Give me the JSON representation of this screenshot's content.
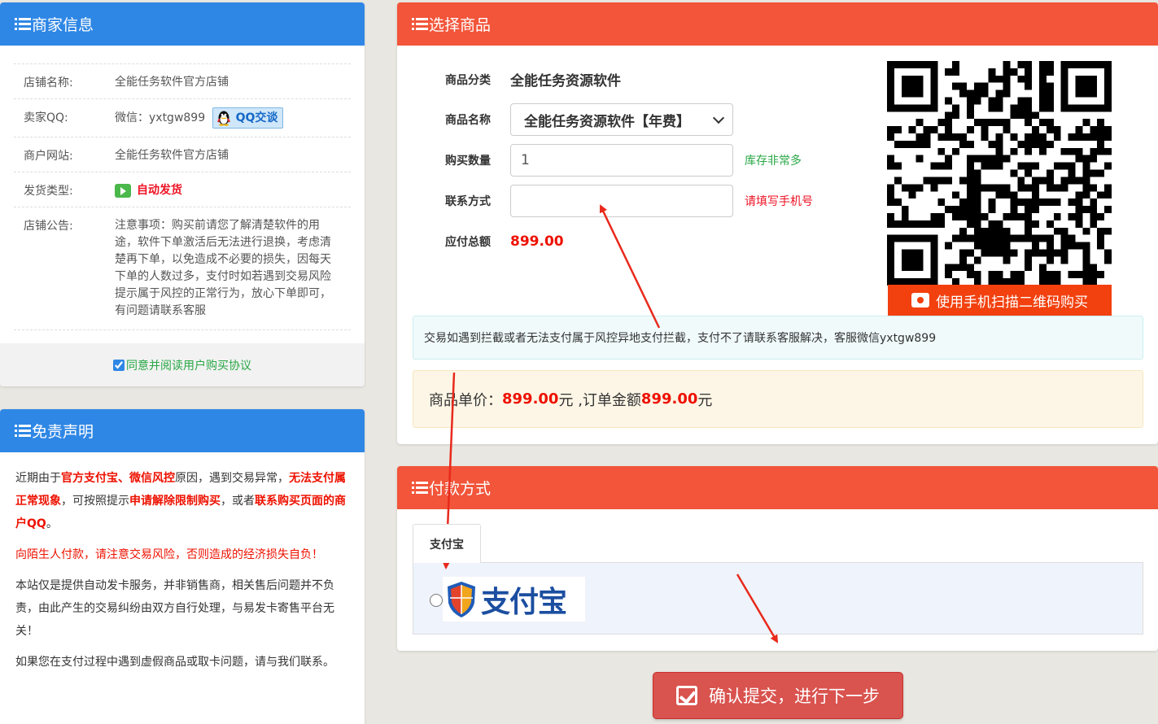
{
  "merchant": {
    "title": "商家信息",
    "rows": [
      {
        "key": "店铺名称:",
        "value": "全能任务软件官方店铺"
      },
      {
        "key": "卖家QQ:",
        "value": "微信：yxtgw899"
      },
      {
        "key": "商户网站:",
        "value": "全能任务软件官方店铺"
      },
      {
        "key": "发货类型:",
        "value": "自动发货"
      },
      {
        "key": "店铺公告:",
        "value": "注意事项：购买前请您了解清楚软件的用途，软件下单激活后无法进行退换，考虑清楚再下单，以免造成不必要的损失，因每天下单的人数过多，支付时如若遇到交易风险提示属于风控的正常行为，放心下单即可，有问题请联系客服"
      }
    ],
    "qq_button": "QQ交谈",
    "agree_label": "同意并阅读用户购买协议",
    "agree_checked": true
  },
  "disclaimer": {
    "title": "免责声明",
    "p1": {
      "a": "近期由于",
      "b": "官方支付宝、微信风控",
      "c": "原因，遇到交易异常，",
      "d": "无法支付属正常现象",
      "e": "，可按照提示",
      "f": "申请解除限制购买",
      "g": "，或者",
      "h": "联系购买页面的商户QQ",
      "i": "。"
    },
    "p2": "向陌生人付款，请注意交易风险，否则造成的经济损失自负！",
    "p3": "本站仅是提供自动发卡服务，并非销售商，相关售后问题并不负责，由此产生的交易纠纷由双方自行处理，与易发卡寄售平台无关！",
    "p4": "如果您在支付过程中遇到虚假商品或取卡问题，请与我们联系。"
  },
  "product": {
    "title": "选择商品",
    "category_label": "商品分类",
    "category_value": "全能任务资源软件",
    "name_label": "商品名称",
    "name_value": "全能任务资源软件【年费】",
    "qty_label": "购买数量",
    "qty_value": "1",
    "stock_hint": "库存非常多",
    "contact_label": "联系方式",
    "contact_value": "",
    "contact_hint": "请填写手机号",
    "total_label": "应付总额",
    "total_value": "899.00",
    "qr_caption": "使用手机扫描二维码购买",
    "risk_notice": "交易如遇到拦截或者无法支付属于风控异地支付拦截，支付不了请联系客服解决，客服微信yxtgw899",
    "price_line": {
      "a": "商品单价：",
      "unit_price": "899.00",
      "b": "元 ,订单金额",
      "order_total": "899.00",
      "c": "元"
    }
  },
  "payment": {
    "title": "付款方式",
    "tab_label": "支付宝",
    "alipay_logo_text": "支付宝"
  },
  "submit_label": "确认提交，进行下一步",
  "colors": {
    "blue_header": "#2f87e5",
    "red_header": "#f2553a",
    "price_red": "#ee1100",
    "submit_red": "#d9534f"
  }
}
